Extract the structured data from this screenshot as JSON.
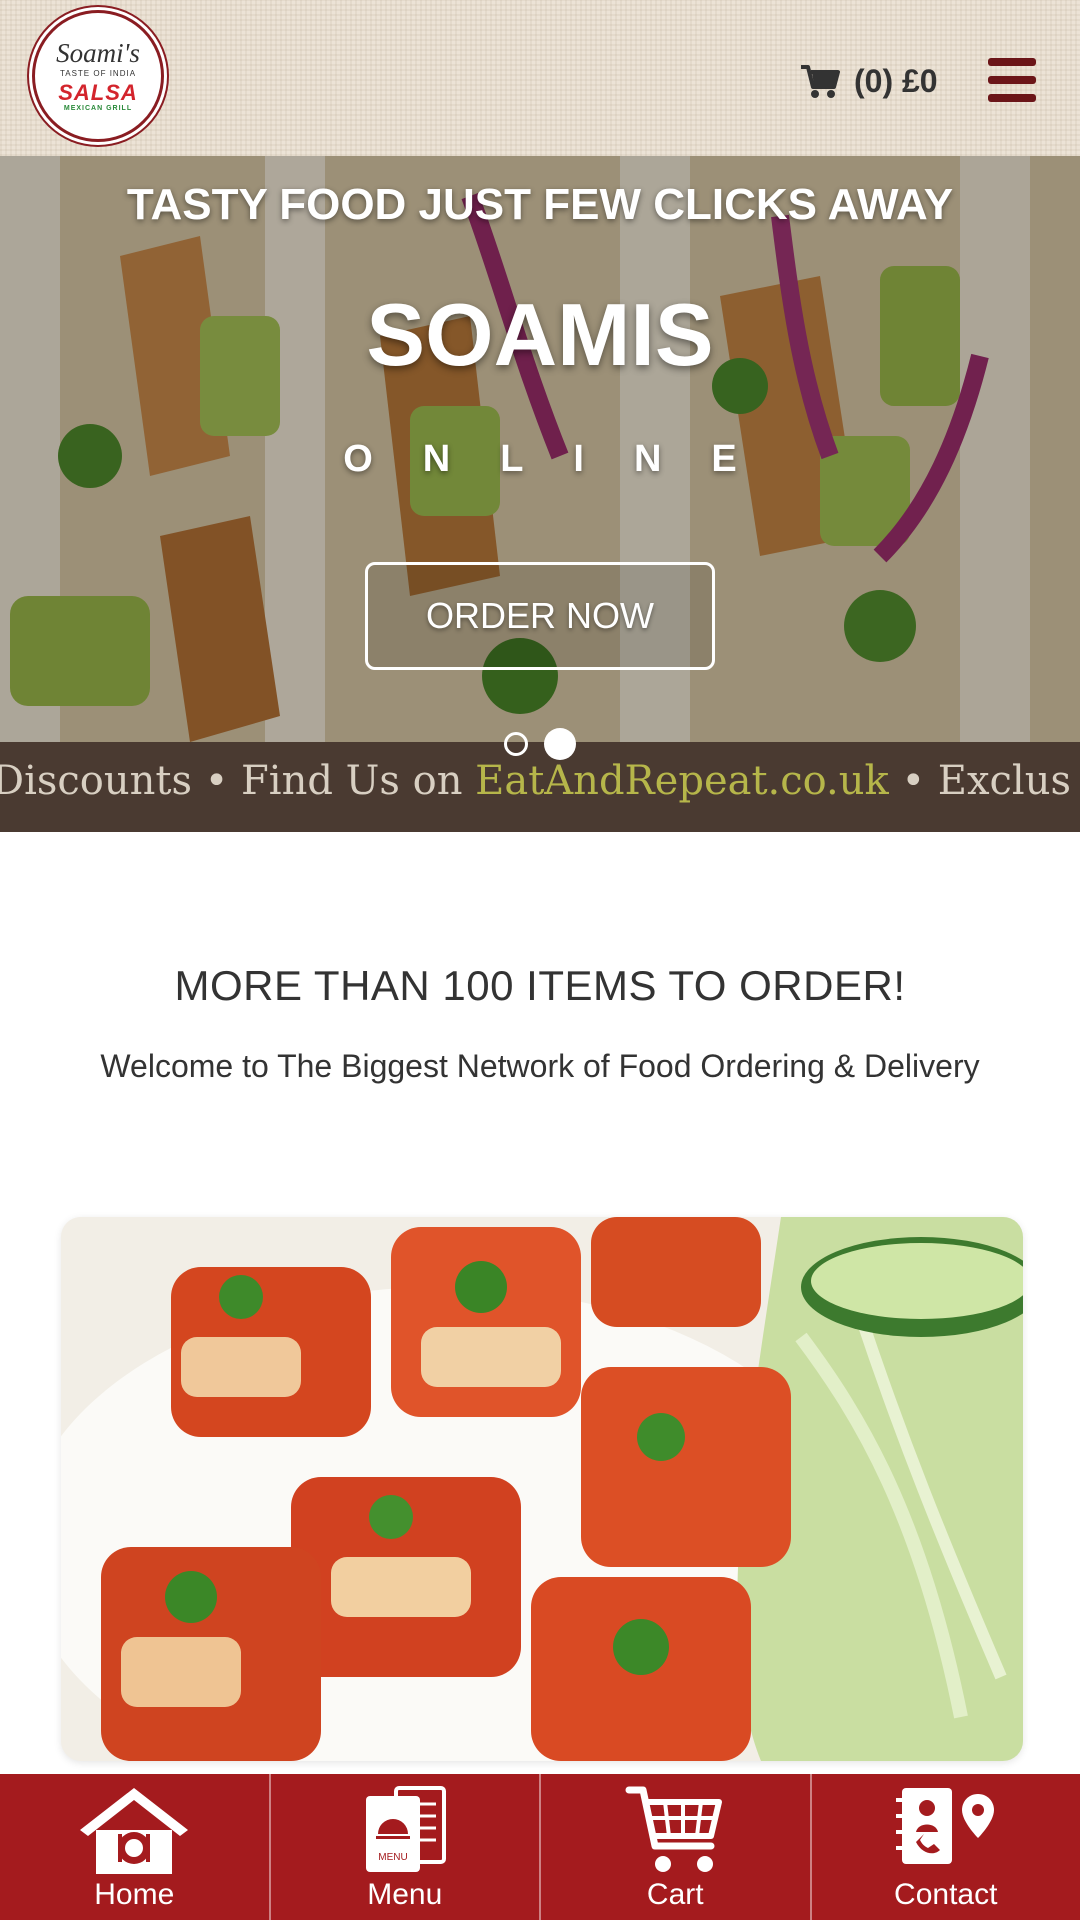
{
  "header": {
    "logo": {
      "script": "Soami's",
      "tagline": "TASTE OF INDIA",
      "name": "SALSA",
      "sub": "MEXICAN GRILL"
    },
    "cart": {
      "label": "(0) £0",
      "icon": "cart-icon"
    },
    "menu_icon": "hamburger-icon"
  },
  "hero": {
    "tagline": "TASTY FOOD JUST FEW CLICKS AWAY",
    "title": "SOAMIS",
    "subtitle": "ONLINE",
    "cta": "ORDER NOW",
    "slides": 2,
    "active_slide": 2
  },
  "ticker": {
    "before": "Discounts • Find Us on ",
    "link": "EatAndRepeat.co.uk",
    "after": " • Exclus"
  },
  "main": {
    "headline": "MORE THAN 100 ITEMS TO ORDER!",
    "welcome": "Welcome to The Biggest Network of Food Ordering & Delivery"
  },
  "bottom_nav": [
    {
      "label": "Home",
      "icon": "home-icon"
    },
    {
      "label": "Menu",
      "icon": "menu-book-icon",
      "icon_text": "MENU"
    },
    {
      "label": "Cart",
      "icon": "cart-icon"
    },
    {
      "label": "Contact",
      "icon": "contact-icon"
    }
  ],
  "colors": {
    "brand_red": "#a41b1e",
    "ticker_bg": "#4a3a31",
    "link_color": "#b6b64a",
    "menu_icon": "#6b1518"
  }
}
